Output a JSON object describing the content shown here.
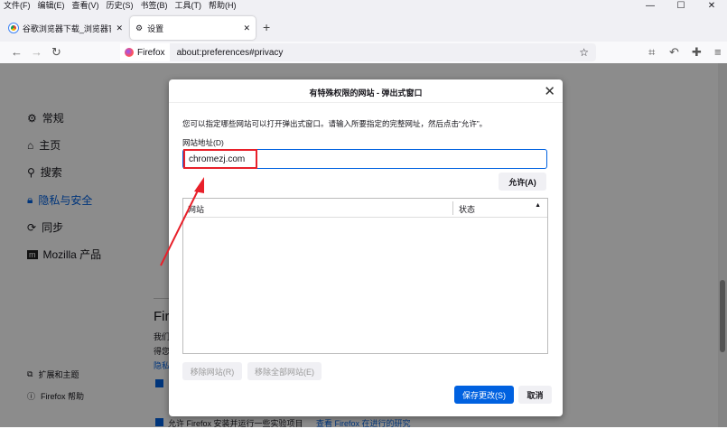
{
  "menu": [
    "文件(F)",
    "编辑(E)",
    "查看(V)",
    "历史(S)",
    "书签(B)",
    "工具(T)",
    "帮助(H)"
  ],
  "window_controls": [
    "—",
    "☐",
    "✕"
  ],
  "tabs": [
    {
      "label": "谷歌浏览器下载_浏览器官网入口"
    },
    {
      "label": "设置"
    }
  ],
  "new_tab": "+",
  "url": {
    "identity": "Firefox",
    "address": "about:preferences#privacy"
  },
  "sidebar": {
    "items": [
      {
        "label": "常规",
        "icon": "gear-icon"
      },
      {
        "label": "主页",
        "icon": "home-icon"
      },
      {
        "label": "搜索",
        "icon": "search-icon"
      },
      {
        "label": "隐私与安全",
        "icon": "lock-icon"
      },
      {
        "label": "同步",
        "icon": "sync-icon"
      },
      {
        "label": "Mozilla 产品",
        "icon": "mozilla-icon"
      }
    ],
    "footer": [
      {
        "label": "扩展和主题"
      },
      {
        "label": "Firefox 帮助"
      }
    ]
  },
  "background": {
    "heading": "Fire",
    "line1": "我们",
    "line2": "得您",
    "link": "隐私",
    "bottom": "允许 Firefox 安装并运行一些实验项目",
    "bottom_link": "查看 Firefox 在进行的研究"
  },
  "dialog": {
    "title": "有特殊权限的网站 - 弹出式窗口",
    "description": "您可以指定哪些网站可以打开弹出式窗口。请输入所要指定的完整网址，然后点击“允许”。",
    "address_label": "网站地址(D)",
    "address_value": "chromezj.com",
    "allow": "允许(A)",
    "col_site": "网站",
    "col_status": "状态",
    "remove": "移除网站(R)",
    "remove_all": "移除全部网站(E)",
    "save": "保存更改(S)",
    "cancel": "取消"
  },
  "colors": {
    "accent": "#0061e0",
    "annotation": "#e8202a"
  }
}
